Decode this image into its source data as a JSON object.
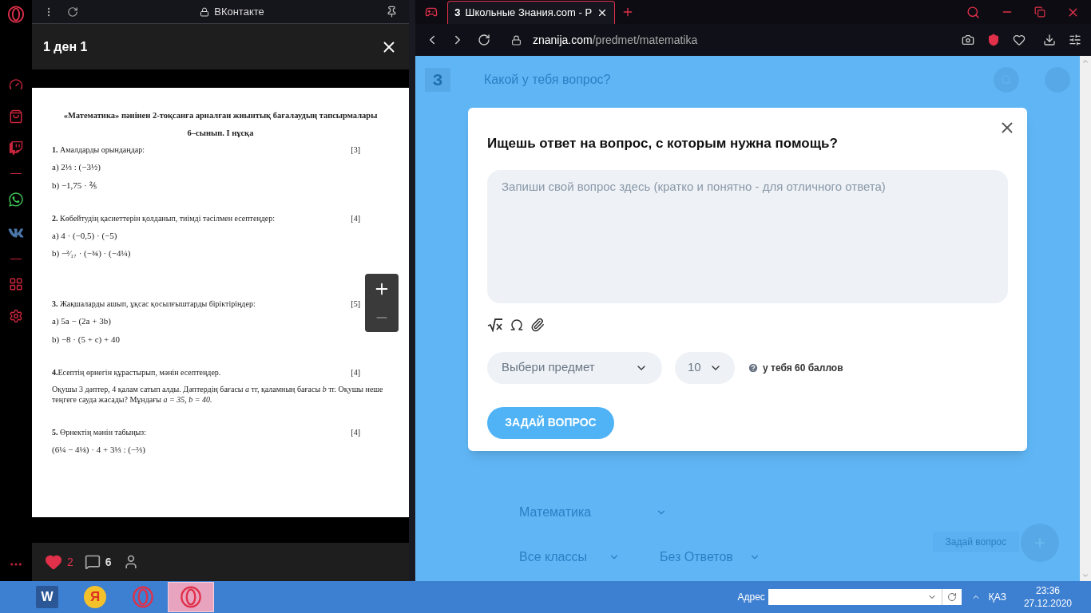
{
  "viewer": {
    "site": "ВКонтакте",
    "title": "1 ден 1",
    "likes": {
      "count": "2",
      "liked": true
    },
    "comments": "6",
    "document": {
      "heading": "«Математика» пәнінен 2-тоқсанға арналған жиынтық бағалаудың тапсырмалары",
      "subheading": "6–сынып. I нұсқа",
      "tasks": [
        {
          "number": "1.",
          "text": "Амалдарды орындаңдар:",
          "points": "[3]",
          "items": [
            "a) 2⅓ : (−3½)",
            "b) −1,75 · ⅖"
          ]
        },
        {
          "number": "2.",
          "text": "Көбейтудің қасиеттерін қолданып, тиімді тәсілмен есептеңдер:",
          "points": "[4]",
          "items": [
            "a) 4 · (−0,5) · (−5)",
            "b) −²⁄₁₇ · (−¾) · (−4¼)"
          ]
        },
        {
          "number": "3.",
          "text": "Жақшаларды ашып, ұқсас қосылғыштарды біріктіріңдер:",
          "points": "[5]",
          "items": [
            "a) 5a − (2a + 3b)",
            "b) −8 · (5 + c) + 40"
          ]
        },
        {
          "number": "4.",
          "text": "Есептің өрнегін құрастырып, мәнін есептеңдер.",
          "points": "[4]",
          "paragraph": "Оқушы 3 дәптер, 4  қалам сатып алды. Дәптердің бағасы *a* тг, қаламның бағасы *b* тг. Оқушы неше теңгеге сауда жасады? Мұндағы *a = 35, b = 40.*"
        },
        {
          "number": "5.",
          "text": "Өрнектің мәнін табыңыз:",
          "points": "[4]",
          "items": [
            "(6¼ − 4⅛) · 4 + 3⅓ : (−⅔)"
          ]
        }
      ]
    }
  },
  "browser": {
    "tabs": [
      {
        "favicon": "З",
        "title": "Школьные Знания.com - Р",
        "selected": true
      }
    ],
    "address": {
      "host": "znanija.com",
      "path": "/predmet/matematika"
    },
    "page": {
      "logo": "З",
      "search_placeholder": "Какой у тебя вопрос?",
      "filters": [
        {
          "label": "Математика"
        },
        {
          "label": "Все классы"
        },
        {
          "label": "Без Ответов"
        }
      ],
      "ask_button": "Задай вопрос",
      "modal": {
        "title": "Ищешь ответ на вопрос, с которым нужна помощь?",
        "question_placeholder": "Запиши свой вопрос здесь (кратко и понятно - для отличного ответа)",
        "subject_placeholder": "Выбери предмет",
        "grade": "10",
        "points_note": "у тебя 60 баллов",
        "submit": "ЗАДАЙ ВОПРОС"
      }
    }
  },
  "taskbar": {
    "apps": [
      {
        "kind": "word",
        "glyph": "W",
        "selected": false
      },
      {
        "kind": "yandex",
        "glyph": "Я",
        "selected": false
      },
      {
        "kind": "opera",
        "selected": false
      },
      {
        "kind": "opera",
        "selected": true
      }
    ],
    "address_label": "Адрес",
    "language": "ҚАЗ",
    "time": "23:36",
    "date": "27.12.2020"
  }
}
